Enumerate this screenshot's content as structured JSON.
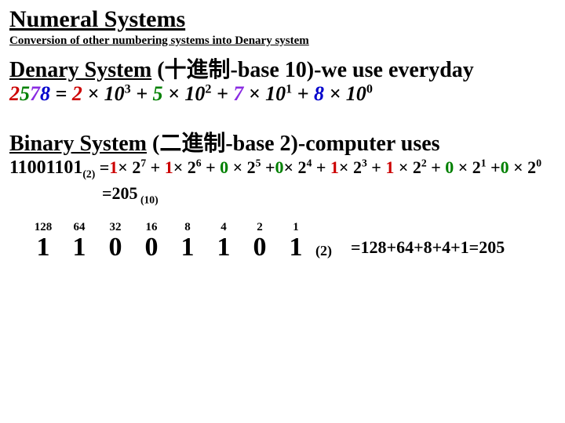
{
  "title": "Numeral Systems",
  "subtitle": "Conversion of other numbering systems into Denary system",
  "denary": {
    "head_u": "Denary System",
    "head_rest": " (十進制-base 10)-we use everyday",
    "num_d0": "2",
    "num_d1": "5",
    "num_d2": "7",
    "num_d3": "8",
    "eq_sp": "   = ",
    "t0a": "2",
    "t0b": " × 10",
    "t0e": "3",
    "plus_wide": "   +   ",
    "t1a": "5",
    "t1b": " × 10",
    "t1e": "2",
    "plus": " + ",
    "t2a": "7",
    "t2b": " × 10",
    "t2e": "1",
    "t3a": "8",
    "t3b": " × 10",
    "t3e": "0"
  },
  "binary": {
    "head_u": "Binary System",
    "head_rest": " (二進制-base 2)-computer uses",
    "num": "11001101",
    "numsub": "(2)",
    "eq": " =",
    "b7a": "1",
    "b7m": "× 2",
    "b7e": "7",
    "b6a": "1",
    "b6m": "× 2",
    "b6e": "6",
    "b5a": "0",
    "b5m": " × 2",
    "b5e": "5",
    "b4a": "0",
    "b4m": "× 2",
    "b4e": "4",
    "b3a": "1",
    "b3m": "× 2",
    "b3e": "3",
    "b2a": "1",
    "b2m": " × 2",
    "b2e": "2",
    "b1a": "0",
    "b1m": " × 2",
    "b1e": "1",
    "b0a": "0",
    "b0m": " × 2",
    "b0e": "0",
    "plus": " + ",
    "plusn": " +",
    "result_eq": "=205",
    "result_sub": " (10)"
  },
  "table": {
    "h": [
      "128",
      "64",
      "32",
      "16",
      "8",
      "4",
      "2",
      "1"
    ],
    "v": [
      "1",
      "1",
      "0",
      "0",
      "1",
      "1",
      "0",
      "1"
    ],
    "sub": "(2)",
    "sum": "=128+64+8+4+1=205"
  }
}
